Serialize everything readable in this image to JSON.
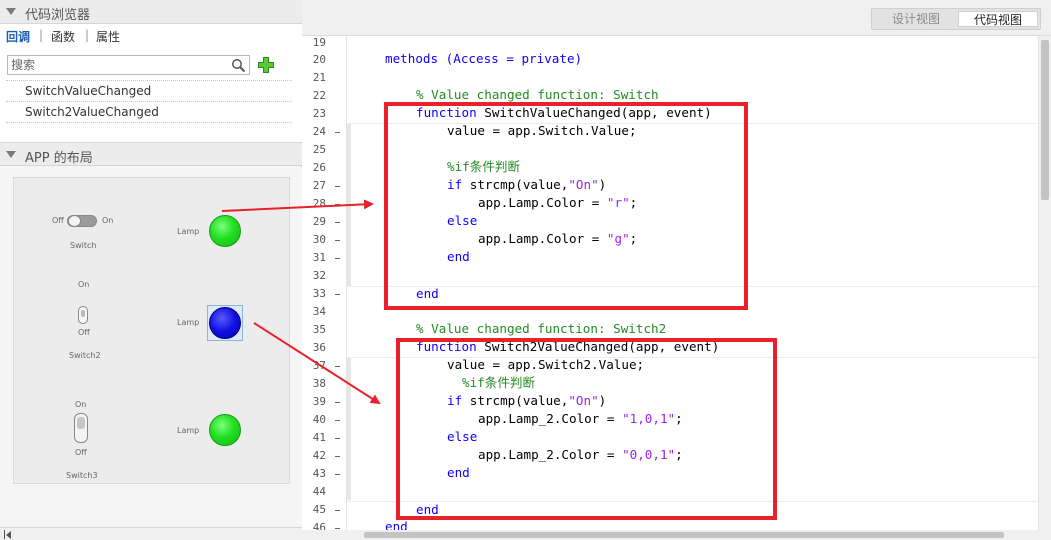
{
  "code_browser": {
    "title": "代码浏览器",
    "tabs": [
      "回调",
      "函数",
      "属性"
    ],
    "tab_separator": "|",
    "search_placeholder": "搜索",
    "callbacks": [
      "SwitchValueChanged",
      "Switch2ValueChanged"
    ]
  },
  "app_layout": {
    "title": "APP 的布局",
    "switch1": {
      "off": "Off",
      "on": "On",
      "name": "Switch"
    },
    "switch2": {
      "on": "On",
      "off": "Off",
      "name": "Switch2"
    },
    "switch3": {
      "on": "On",
      "off": "Off",
      "name": "Switch3"
    },
    "lamp_label": "Lamp",
    "lamp_colors": {
      "lamp1": "#22e022",
      "lamp2": "#1010e0",
      "lamp3": "#22e022"
    }
  },
  "view_toggle": {
    "design": "设计视图",
    "code": "代码视图"
  },
  "editor": {
    "line_numbers": [
      "19",
      "20",
      "21",
      "22",
      "23",
      "24",
      "25",
      "26",
      "27",
      "28",
      "29",
      "30",
      "31",
      "32",
      "33",
      "34",
      "35",
      "36",
      "37",
      "38",
      "39",
      "40",
      "41",
      "42",
      "43",
      "44",
      "45",
      "46"
    ],
    "line_texts": {
      "l20": "methods (Access = private)",
      "l22": "% Value changed function: Switch",
      "l23a": "function",
      "l23b": " SwitchValueChanged(app, event)",
      "l24": "value = app.Switch.Value;",
      "l26": "%if条件判断",
      "l27a": "if",
      "l27b": " strcmp(value,",
      "l27c": "\"On\"",
      "l27d": ")",
      "l28a": "app.Lamp.Color = ",
      "l28b": "\"r\"",
      "l28c": ";",
      "l29": "else",
      "l30a": "app.Lamp.Color = ",
      "l30b": "\"g\"",
      "l30c": ";",
      "l31": "end",
      "l33": "end",
      "l35": "% Value changed function: Switch2",
      "l36a": "function",
      "l36b": " Switch2ValueChanged(app, event)",
      "l37": "value = app.Switch2.Value;",
      "l38": "%if条件判断",
      "l39a": "if",
      "l39b": " strcmp(value,",
      "l39c": "\"On\"",
      "l39d": ")",
      "l40a": "app.Lamp_2.Color = ",
      "l40b": "\"1,0,1\"",
      "l40c": ";",
      "l41": "else",
      "l42a": "app.Lamp_2.Color = ",
      "l42b": "\"0,0,1\"",
      "l42c": ";",
      "l43": "end",
      "l45": "end",
      "l46": "end"
    }
  }
}
